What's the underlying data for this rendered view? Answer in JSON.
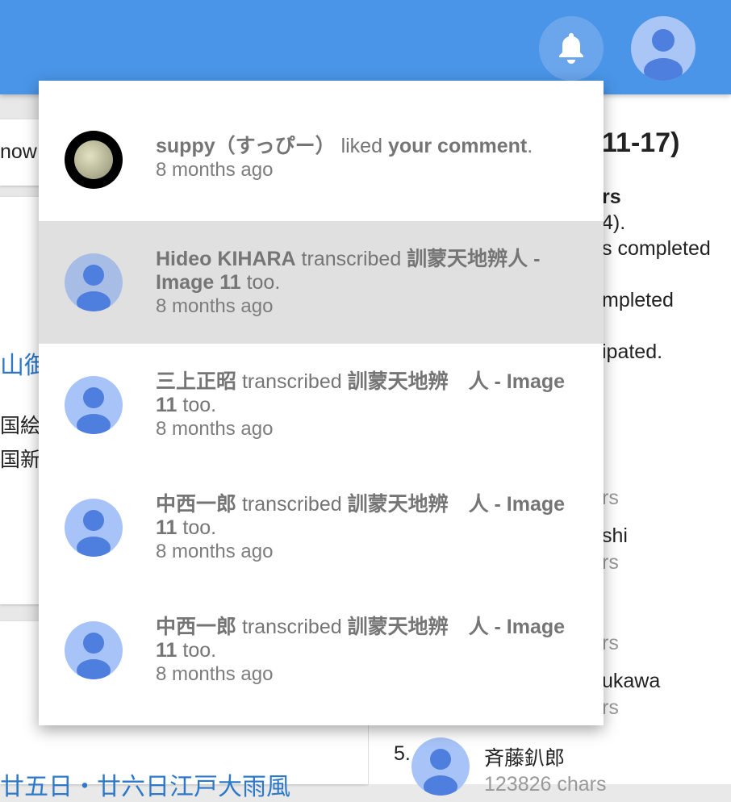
{
  "header": {
    "bell_icon": "bell-icon",
    "avatar_icon": "person-icon",
    "brand_color": "#4a95e8"
  },
  "background": {
    "left_fragment_1": "now",
    "left_link": "山御",
    "left_fragment_2": "国絵図",
    "left_fragment_3": "国新日",
    "left_bottom_link": "廿五日・廿六日江戸大雨風",
    "right_title": "11-17)",
    "right_line_1": "rs",
    "right_line_2": "4).",
    "right_line_3": "s completed",
    "right_line_4": "mpleted",
    "right_line_5": "ipated.",
    "right_chars_1": "rs",
    "right_name_1": "shi",
    "right_chars_2": "rs",
    "right_chars_3": "rs",
    "right_name_2": "ukawa",
    "right_chars_4": "rs",
    "rank_5_number": "5.",
    "rank_5_name": "斉藤釟郎",
    "rank_5_chars": "123826 chars"
  },
  "notifications": [
    {
      "actor": "suppy（すっぴー）",
      "verb": " liked ",
      "object": "your comment",
      "suffix": ".",
      "time": "8 months ago",
      "avatar": "moon-photo",
      "highlighted": false
    },
    {
      "actor": "Hideo KIHARA",
      "verb": " transcribed ",
      "object": "訓蒙天地辨人 - Image 11",
      "suffix": " too.",
      "time": "8 months ago",
      "avatar": "default-user-icon",
      "highlighted": true
    },
    {
      "actor": "三上正昭",
      "verb": " transcribed ",
      "object": "訓蒙天地辨　人 - Image 11",
      "suffix": " too.",
      "time": "8 months ago",
      "avatar": "default-user-icon",
      "highlighted": false
    },
    {
      "actor": "中西一郎",
      "verb": " transcribed ",
      "object": "訓蒙天地辨　人 - Image 11",
      "suffix": " too.",
      "time": "8 months ago",
      "avatar": "default-user-icon",
      "highlighted": false
    },
    {
      "actor": "中西一郎",
      "verb": " transcribed ",
      "object": "訓蒙天地辨　人 - Image 11",
      "suffix": " too.",
      "time": "8 months ago",
      "avatar": "default-user-icon",
      "highlighted": false
    }
  ]
}
